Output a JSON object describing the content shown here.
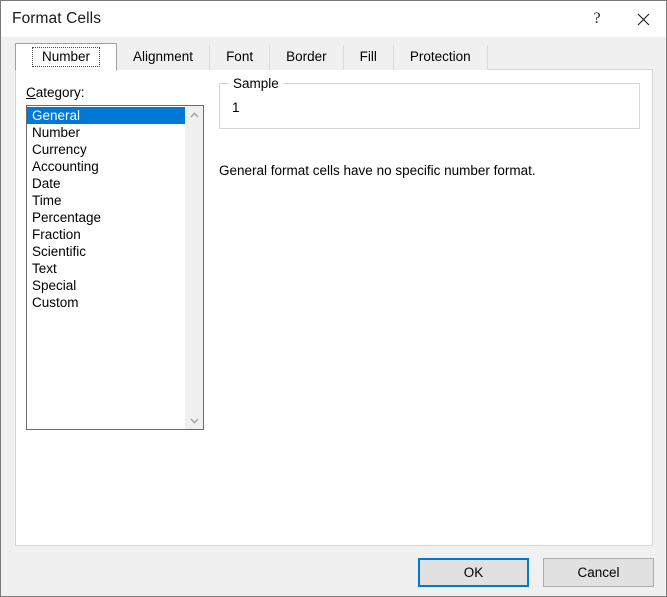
{
  "window": {
    "title": "Format Cells",
    "help_icon": "help-question-icon",
    "help_glyph": "?",
    "close_icon": "close-icon"
  },
  "tabs": [
    {
      "label": "Number",
      "selected": true
    },
    {
      "label": "Alignment",
      "selected": false
    },
    {
      "label": "Font",
      "selected": false
    },
    {
      "label": "Border",
      "selected": false
    },
    {
      "label": "Fill",
      "selected": false
    },
    {
      "label": "Protection",
      "selected": false
    }
  ],
  "number_tab": {
    "category": {
      "label_accel": "C",
      "label_rest": "ategory:",
      "items": [
        "General",
        "Number",
        "Currency",
        "Accounting",
        "Date",
        "Time",
        "Percentage",
        "Fraction",
        "Scientific",
        "Text",
        "Special",
        "Custom"
      ],
      "selected_index": 0,
      "scroll_up_icon": "chevron-up-icon",
      "scroll_down_icon": "chevron-down-icon"
    },
    "sample": {
      "legend": "Sample",
      "value": "1"
    },
    "description": "General format cells have no specific number format."
  },
  "footer": {
    "ok_label": "OK",
    "cancel_label": "Cancel"
  },
  "colors": {
    "accent": "#0078D7",
    "dialog_background": "#F0F0F0",
    "panel_background": "#FFFFFF",
    "button_face": "#E1E1E1",
    "button_border": "#ADADAD"
  }
}
